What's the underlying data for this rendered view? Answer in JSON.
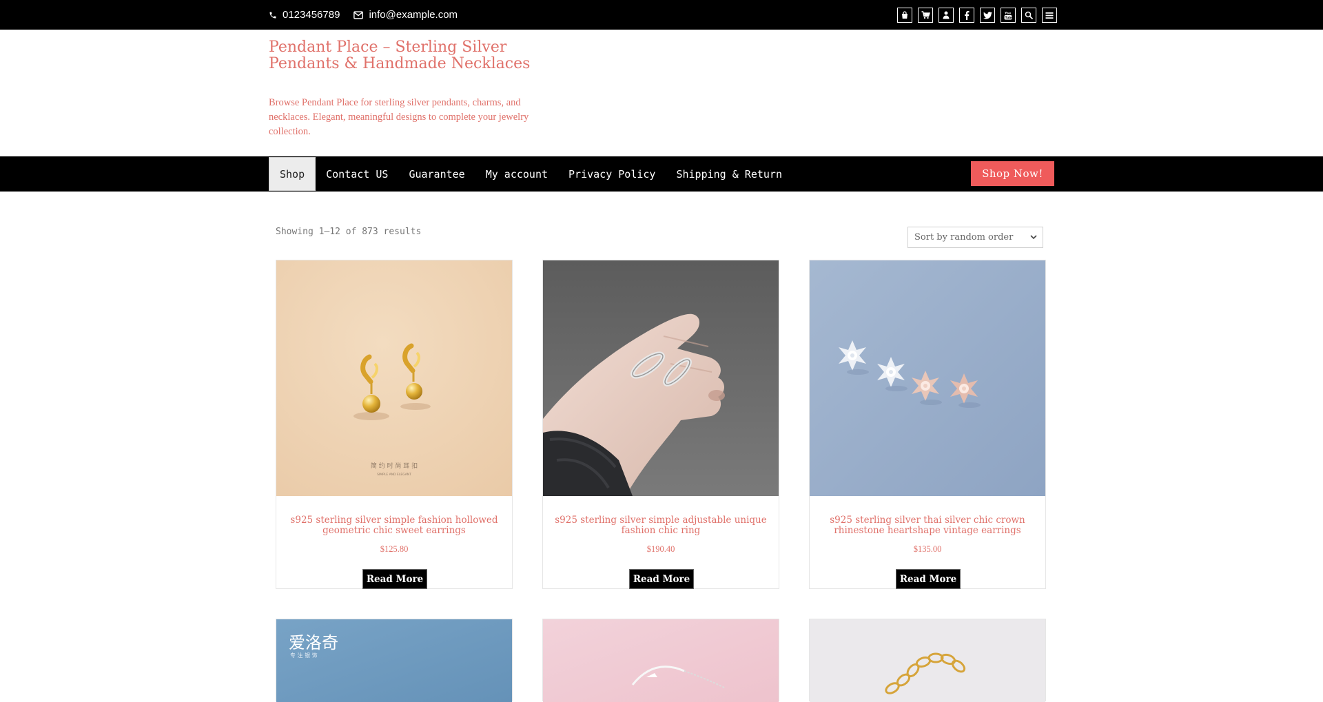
{
  "topbar": {
    "phone": "0123456789",
    "email": "info@example.com",
    "icons": [
      "shopping-bag-icon",
      "cart-icon",
      "user-icon",
      "facebook-icon",
      "twitter-icon",
      "youtube-icon",
      "search-icon",
      "menu-icon"
    ]
  },
  "header": {
    "title": "Pendant Place – Sterling Silver Pendants & Handmade Necklaces",
    "description": "Browse Pendant Place for sterling silver pendants, charms, and necklaces. Elegant, meaningful designs to complete your jewelry collection."
  },
  "nav": {
    "items": [
      {
        "label": "Shop",
        "active": true
      },
      {
        "label": "Contact US"
      },
      {
        "label": "Guarantee"
      },
      {
        "label": "My account"
      },
      {
        "label": "Privacy Policy"
      },
      {
        "label": "Shipping & Return"
      }
    ],
    "cta": "Shop Now!"
  },
  "shop": {
    "results": "Showing 1–12 of 873 results",
    "sort_selected": "Sort by random order"
  },
  "products": [
    {
      "name": "s925 sterling silver simple fashion hollowed geometric chic sweet earrings",
      "price": "$125.80",
      "button": "Read More",
      "image_caption": "简 约 时 尚 耳 扣",
      "image_subcaption": "SIMPLE AND ELEGANT"
    },
    {
      "name": "s925 sterling silver simple adjustable unique fashion chic ring",
      "price": "$190.40",
      "button": "Read More"
    },
    {
      "name": "s925 sterling silver thai silver chic crown rhinestone heartshape vintage earrings",
      "price": "$135.00",
      "button": "Read More"
    },
    {
      "image_caption": "爱洛奇",
      "image_subcaption": "专 注 银 饰"
    },
    {},
    {}
  ],
  "colors": {
    "accent": "#e0716a",
    "cta": "#ef5b5b",
    "bar": "#000000"
  }
}
